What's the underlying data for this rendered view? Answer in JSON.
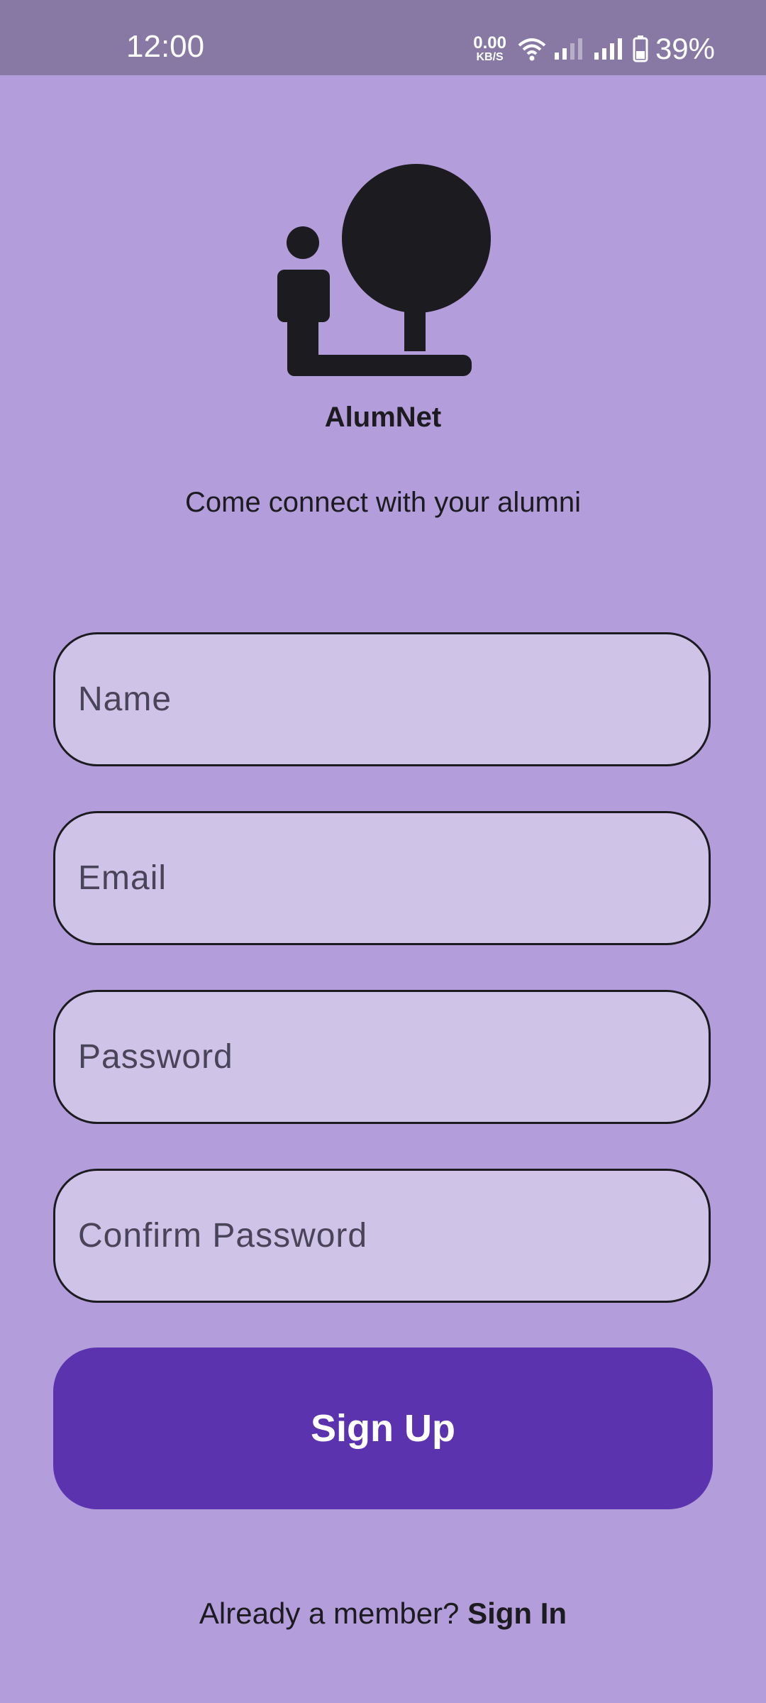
{
  "status_bar": {
    "time": "12:00",
    "net_speed_value": "0.00",
    "net_speed_unit": "KB/S",
    "battery_percent": "39%",
    "icons": [
      "wifi-icon",
      "signal-weak-icon",
      "signal-strong-icon",
      "battery-icon"
    ]
  },
  "app": {
    "name": "AlumNet",
    "tagline": "Come connect with your alumni",
    "logo_icon": "person-tree-logo-icon"
  },
  "form": {
    "name_placeholder": "Name",
    "email_placeholder": "Email",
    "password_placeholder": "Password",
    "confirm_password_placeholder": "Confirm Password",
    "submit_label": "Sign Up"
  },
  "footer": {
    "prompt": "Already a member?",
    "link_label": "Sign In"
  },
  "colors": {
    "background": "#b39ddb",
    "status_bar": "#8878a4",
    "field_fill": "#d0c3e8",
    "button": "#5b33af",
    "text_dark": "#1c1b1f"
  }
}
